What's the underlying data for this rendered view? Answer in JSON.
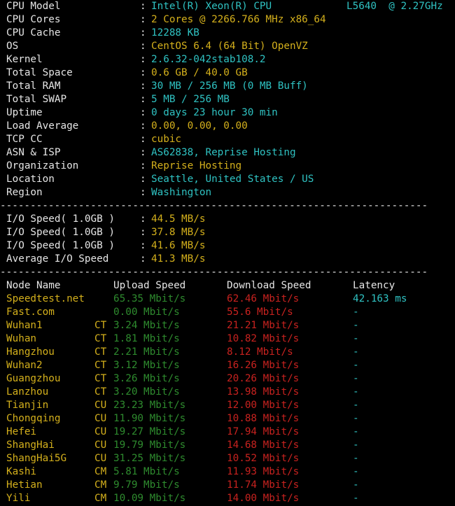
{
  "sysinfo": [
    {
      "key": "CPU Model",
      "value": "Intel(R) Xeon(R) CPU",
      "extra": "L5640  @ 2.27GHz",
      "color": "cyan"
    },
    {
      "key": "CPU Cores",
      "value": "2 Cores @ 2266.766 MHz x86_64",
      "color": "yellow"
    },
    {
      "key": "CPU Cache",
      "value": "12288 KB",
      "color": "cyan"
    },
    {
      "key": "OS",
      "value": "CentOS 6.4 (64 Bit) OpenVZ",
      "color": "yellow"
    },
    {
      "key": "Kernel",
      "value": "2.6.32-042stab108.2",
      "color": "cyan"
    },
    {
      "key": "Total Space",
      "value": "0.6 GB / 40.0 GB",
      "color": "yellow"
    },
    {
      "key": "Total RAM",
      "value": "30 MB / 256 MB (0 MB Buff)",
      "color": "cyan"
    },
    {
      "key": "Total SWAP",
      "value": "5 MB / 256 MB",
      "color": "cyan"
    },
    {
      "key": "Uptime",
      "value": "0 days 23 hour 30 min",
      "color": "cyan"
    },
    {
      "key": "Load Average",
      "value": "0.00, 0.00, 0.00",
      "color": "yellow"
    },
    {
      "key": "TCP CC",
      "value": "cubic",
      "color": "yellow"
    },
    {
      "key": "ASN & ISP",
      "value": "AS62838, Reprise Hosting",
      "color": "cyan"
    },
    {
      "key": "Organization",
      "value": "Reprise Hosting",
      "color": "yellow"
    },
    {
      "key": "Location",
      "value": "Seattle, United States / US",
      "color": "cyan"
    },
    {
      "key": "Region",
      "value": "Washington",
      "color": "cyan"
    }
  ],
  "separator": ":",
  "divider": "-----------------------------------------------------------------------",
  "io": [
    {
      "key": "I/O Speed( 1.0GB )",
      "value": "44.5 MB/s"
    },
    {
      "key": "I/O Speed( 1.0GB )",
      "value": "37.8 MB/s"
    },
    {
      "key": "I/O Speed( 1.0GB )",
      "value": "41.6 MB/s"
    },
    {
      "key": "Average I/O Speed",
      "value": "41.3 MB/s"
    }
  ],
  "speed_headers": {
    "node": "Node Name",
    "upload": "Upload Speed",
    "download": "Download Speed",
    "latency": "Latency"
  },
  "speed_rows": [
    {
      "node": "Speedtest.net",
      "isp": "",
      "upload": "65.35 Mbit/s",
      "download": "62.46 Mbit/s",
      "latency": "42.163 ms"
    },
    {
      "node": "Fast.com",
      "isp": "",
      "upload": "0.00 Mbit/s",
      "download": "55.6 Mbit/s",
      "latency": "-"
    },
    {
      "node": "Wuhan1",
      "isp": "CT",
      "upload": "3.24 Mbit/s",
      "download": "21.21 Mbit/s",
      "latency": "-"
    },
    {
      "node": "Wuhan",
      "isp": "CT",
      "upload": "1.81 Mbit/s",
      "download": "10.82 Mbit/s",
      "latency": "-"
    },
    {
      "node": "Hangzhou",
      "isp": "CT",
      "upload": "2.21 Mbit/s",
      "download": "8.12 Mbit/s",
      "latency": "-"
    },
    {
      "node": "Wuhan2",
      "isp": "CT",
      "upload": "3.12 Mbit/s",
      "download": "16.26 Mbit/s",
      "latency": "-"
    },
    {
      "node": "Guangzhou",
      "isp": "CT",
      "upload": "3.26 Mbit/s",
      "download": "20.26 Mbit/s",
      "latency": "-"
    },
    {
      "node": "Lanzhou",
      "isp": "CT",
      "upload": "3.20 Mbit/s",
      "download": "13.98 Mbit/s",
      "latency": "-"
    },
    {
      "node": "Tianjin",
      "isp": "CU",
      "upload": "23.23 Mbit/s",
      "download": "12.00 Mbit/s",
      "latency": "-"
    },
    {
      "node": "Chongqing",
      "isp": "CU",
      "upload": "11.90 Mbit/s",
      "download": "10.88 Mbit/s",
      "latency": "-"
    },
    {
      "node": "Hefei",
      "isp": "CU",
      "upload": "19.27 Mbit/s",
      "download": "17.94 Mbit/s",
      "latency": "-"
    },
    {
      "node": "ShangHai",
      "isp": "CU",
      "upload": "19.79 Mbit/s",
      "download": "14.68 Mbit/s",
      "latency": "-"
    },
    {
      "node": "ShangHai5G",
      "isp": "CU",
      "upload": "31.25 Mbit/s",
      "download": "10.52 Mbit/s",
      "latency": "-"
    },
    {
      "node": "Kashi",
      "isp": "CM",
      "upload": "5.81 Mbit/s",
      "download": "11.93 Mbit/s",
      "latency": "-"
    },
    {
      "node": "Hetian",
      "isp": "CM",
      "upload": "9.79 Mbit/s",
      "download": "11.74 Mbit/s",
      "latency": "-"
    },
    {
      "node": "Yili",
      "isp": "CM",
      "upload": "10.09 Mbit/s",
      "download": "14.00 Mbit/s",
      "latency": "-"
    }
  ],
  "colors": {
    "cyan": "#2fc2c2",
    "yellow": "#d4b01c",
    "green": "#2e8b2e",
    "red": "#c8221f",
    "text": "#e6e6e6",
    "background": "#000000"
  }
}
